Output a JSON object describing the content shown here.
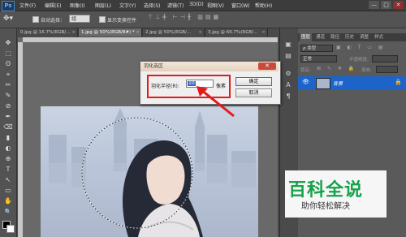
{
  "app": {
    "logo": "Ps"
  },
  "menu": [
    "文件(F)",
    "编辑(E)",
    "图像(I)",
    "图层(L)",
    "文字(Y)",
    "选择(S)",
    "滤镜(T)",
    "3D(D)",
    "视图(V)",
    "窗口(W)",
    "帮助(H)"
  ],
  "window_controls": [
    "—",
    "□",
    "✕"
  ],
  "options_bar": {
    "auto_select_label": "自动选择：",
    "auto_select_value": "组",
    "show_transform_label": "显示变换控件"
  },
  "doc_tabs": [
    {
      "label": "0.jpg @ 16.7%(RGB/...",
      "active": false
    },
    {
      "label": "1.jpg @ 50%(RGB/8#) *",
      "active": true
    },
    {
      "label": "2.jpg @ 50%(RGB/...",
      "active": false
    },
    {
      "label": "3.jpg @ 66.7%(RGB/...",
      "active": false
    }
  ],
  "tab_close": "×",
  "tools": [
    "✥",
    "⬚",
    "ʘ",
    "⌖",
    "✂",
    "✎",
    "⊘",
    "✒",
    "⌫",
    "▮",
    "◐",
    "⊕",
    "T",
    "↖",
    "▭",
    "✋",
    "🔍"
  ],
  "panel_strip_icons": [
    "▣",
    "▤",
    "⚙",
    "A",
    "¶",
    "◧"
  ],
  "layers_panel": {
    "tabs": [
      "图层",
      "通道",
      "路径",
      "历史",
      "调整",
      "样式"
    ],
    "active_tab": "图层",
    "kind_filter": "ρ 类型",
    "blend_mode": "正常",
    "opacity_label": "不透明度:",
    "lock_label": "锁定:",
    "fill_label": "填充:",
    "layer_name": "背景",
    "eye_icon": "👁"
  },
  "dialog": {
    "title": "羽化选区",
    "close": "✕",
    "radius_label": "羽化半径(R):",
    "radius_value": "10",
    "unit": "像素",
    "ok": "确定",
    "cancel": "取消"
  },
  "watermark": {
    "title": "百科全说",
    "subtitle": "助你轻松解决"
  }
}
